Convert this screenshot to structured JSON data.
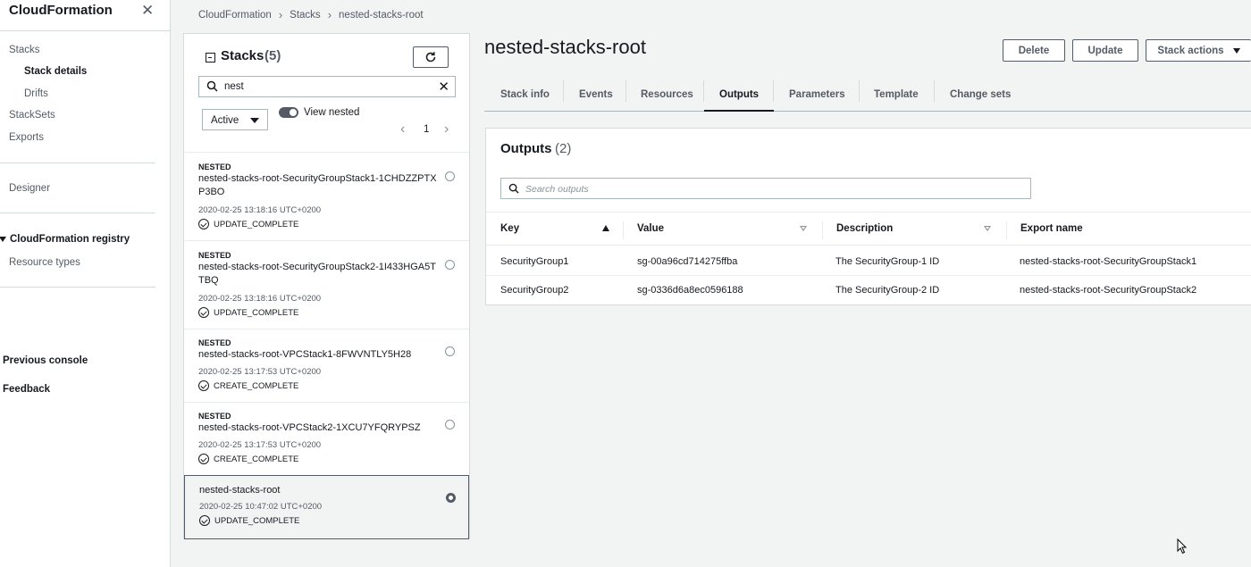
{
  "sidebar": {
    "title": "CloudFormation",
    "items": [
      {
        "label": "Stacks"
      },
      {
        "label": "Stack details"
      },
      {
        "label": "Drifts"
      },
      {
        "label": "StackSets"
      },
      {
        "label": "Exports"
      },
      {
        "label": "Designer"
      },
      {
        "label": "CloudFormation registry"
      },
      {
        "label": "Resource types"
      },
      {
        "label": "Previous console"
      },
      {
        "label": "Feedback"
      }
    ]
  },
  "breadcrumb": [
    "CloudFormation",
    "Stacks",
    "nested-stacks-root"
  ],
  "stack_panel": {
    "title": "Stacks",
    "count": "(5)",
    "search_value": "nest",
    "filter_value": "Active",
    "toggle_label": "View nested",
    "page": "1",
    "stacks": [
      {
        "label": "NESTED",
        "name": "nested-stacks-root-SecurityGroupStack1-1CHDZZPTXP3BO",
        "date": "2020-02-25 13:18:16 UTC+0200",
        "status": "UPDATE_COMPLETE"
      },
      {
        "label": "NESTED",
        "name": "nested-stacks-root-SecurityGroupStack2-1I433HGA5TTBQ",
        "date": "2020-02-25 13:18:16 UTC+0200",
        "status": "UPDATE_COMPLETE"
      },
      {
        "label": "NESTED",
        "name": "nested-stacks-root-VPCStack1-8FWVNTLY5H28",
        "date": "2020-02-25 13:17:53 UTC+0200",
        "status": "CREATE_COMPLETE"
      },
      {
        "label": "NESTED",
        "name": "nested-stacks-root-VPCStack2-1XCU7YFQRYPSZ",
        "date": "2020-02-25 13:17:53 UTC+0200",
        "status": "CREATE_COMPLETE"
      },
      {
        "label": "",
        "name": "nested-stacks-root",
        "date": "2020-02-25 10:47:02 UTC+0200",
        "status": "UPDATE_COMPLETE"
      }
    ]
  },
  "main": {
    "title": "nested-stacks-root",
    "buttons": {
      "delete": "Delete",
      "update": "Update",
      "stack_actions": "Stack actions"
    },
    "tabs": [
      "Stack info",
      "Events",
      "Resources",
      "Outputs",
      "Parameters",
      "Template",
      "Change sets"
    ],
    "active_tab": "Outputs"
  },
  "outputs": {
    "title": "Outputs",
    "count": "(2)",
    "search_placeholder": "Search outputs",
    "columns": [
      "Key",
      "Value",
      "Description",
      "Export name"
    ],
    "rows": [
      [
        "SecurityGroup1",
        "sg-00a96cd714275ffba",
        "The SecurityGroup-1 ID",
        "nested-stacks-root-SecurityGroupStack1"
      ],
      [
        "SecurityGroup2",
        "sg-0336d6a8ec0596188",
        "The SecurityGroup-2 ID",
        "nested-stacks-root-SecurityGroupStack2"
      ]
    ]
  },
  "colors": {
    "text": "#16191f",
    "muted": "#545b64",
    "border": "#d5dbdb",
    "background": "#f2f3f3"
  }
}
